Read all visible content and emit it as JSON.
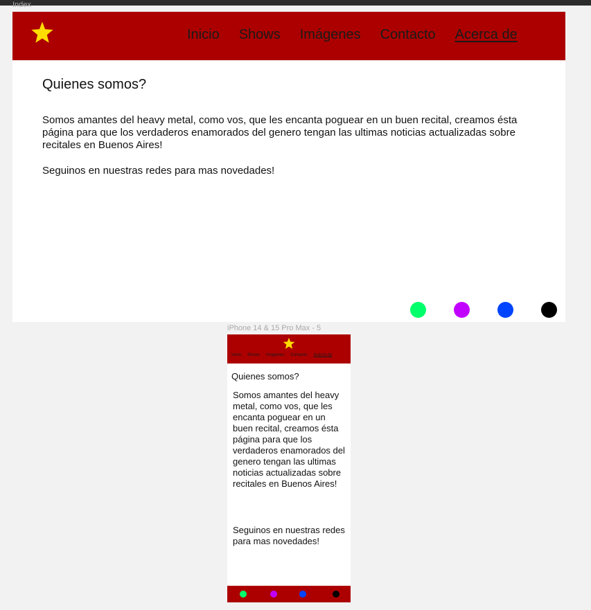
{
  "canvas": {
    "desktop_frame_label": "Index",
    "mobile_frame_label": "iPhone 14 & 15 Pro Max - 5"
  },
  "nav": {
    "items": [
      "Inicio",
      "Shows",
      "Imágenes",
      "Contacto",
      "Acerca de"
    ],
    "active": "Acerca de",
    "logo_icon": "star-icon",
    "colors": {
      "bar": "#ac0000",
      "star": "#ffdd00"
    }
  },
  "about": {
    "title": "Quienes somos?",
    "paragraph1": "Somos amantes del heavy metal, como vos, que les encanta poguear en un buen recital, creamos ésta página para que los verdaderos enamorados del genero tengan las ultimas noticias actualizadas sobre recitales en Buenos Aires!",
    "paragraph2": "Seguinos en nuestras redes para mas novedades!"
  },
  "social": {
    "dots": [
      {
        "name": "social-green-dot",
        "color": "#00ff6a"
      },
      {
        "name": "social-purple-dot",
        "color": "#c200ff"
      },
      {
        "name": "social-blue-dot",
        "color": "#0044ff"
      },
      {
        "name": "social-black-dot",
        "color": "#000000"
      }
    ]
  }
}
